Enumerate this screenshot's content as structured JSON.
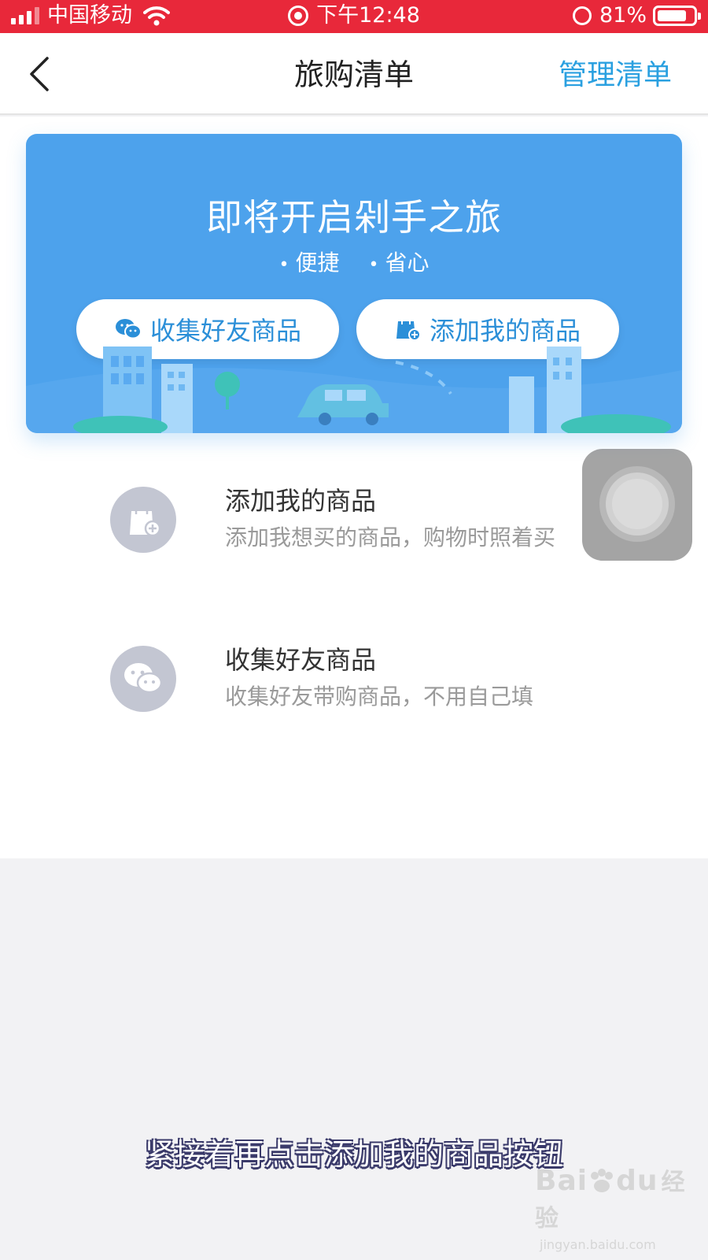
{
  "status_bar": {
    "carrier": "中国移动",
    "time": "下午12:48",
    "battery": "81%",
    "battery_level": 0.81
  },
  "nav": {
    "title": "旅购清单",
    "manage_label": "管理清单"
  },
  "banner": {
    "headline": "即将开启剁手之旅",
    "tags": [
      "便捷",
      "省心"
    ],
    "collect_button": "收集好友商品",
    "add_button": "添加我的商品"
  },
  "options": {
    "add": {
      "title": "添加我的商品",
      "desc": "添加我想买的商品，购物时照着买"
    },
    "collect": {
      "title": "收集好友商品",
      "desc": "收集好友带购商品，不用自己填"
    }
  },
  "caption": "紧接着再点击添加我的商品按钮",
  "watermark": {
    "logo_text": "Bai",
    "logo_tail": "du",
    "logo_cn": "经验",
    "url": "jingyan.baidu.com"
  },
  "colors": {
    "status_bar": "#e8283a",
    "accent": "#2aa0e0",
    "banner": "#4da2ec",
    "icon_circle": "#c3c6d2"
  }
}
